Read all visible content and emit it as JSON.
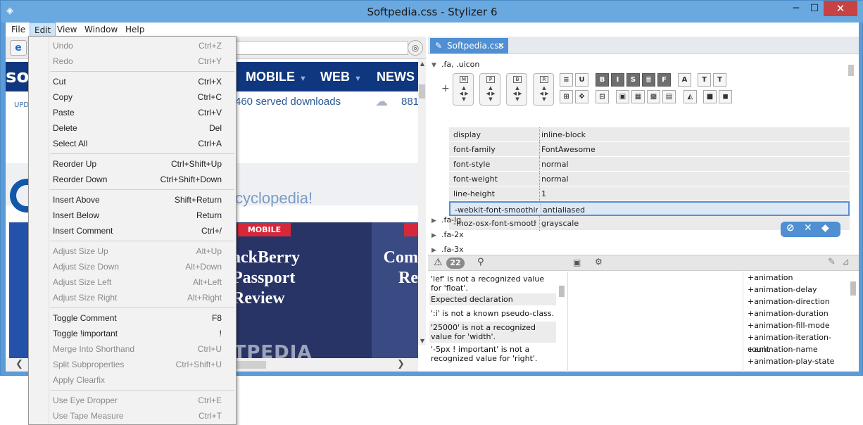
{
  "window": {
    "title": "Softpedia.css - Stylizer 6",
    "minimize": "─",
    "maximize": "☐",
    "close": "✕"
  },
  "menubar": [
    "File",
    "Edit",
    "View",
    "Window",
    "Help"
  ],
  "edit_menu": [
    {
      "label": "Undo",
      "shortcut": "Ctrl+Z",
      "enabled": false
    },
    {
      "label": "Redo",
      "shortcut": "Ctrl+Y",
      "enabled": false
    },
    {
      "label": "Cut",
      "shortcut": "Ctrl+X",
      "enabled": true
    },
    {
      "label": "Copy",
      "shortcut": "Ctrl+C",
      "enabled": true
    },
    {
      "label": "Paste",
      "shortcut": "Ctrl+V",
      "enabled": true
    },
    {
      "label": "Delete",
      "shortcut": "Del",
      "enabled": true
    },
    {
      "label": "Select All",
      "shortcut": "Ctrl+A",
      "enabled": true
    },
    {
      "label": "Reorder Up",
      "shortcut": "Ctrl+Shift+Up",
      "enabled": true
    },
    {
      "label": "Reorder Down",
      "shortcut": "Ctrl+Shift+Down",
      "enabled": true
    },
    {
      "label": "Insert Above",
      "shortcut": "Shift+Return",
      "enabled": true
    },
    {
      "label": "Insert Below",
      "shortcut": "Return",
      "enabled": true
    },
    {
      "label": "Insert Comment",
      "shortcut": "Ctrl+/",
      "enabled": true
    },
    {
      "label": "Adjust Size Up",
      "shortcut": "Alt+Up",
      "enabled": false
    },
    {
      "label": "Adjust Size Down",
      "shortcut": "Alt+Down",
      "enabled": false
    },
    {
      "label": "Adjust Size Left",
      "shortcut": "Alt+Left",
      "enabled": false
    },
    {
      "label": "Adjust Size Right",
      "shortcut": "Alt+Right",
      "enabled": false
    },
    {
      "label": "Toggle Comment",
      "shortcut": "F8",
      "enabled": true
    },
    {
      "label": "Toggle !important",
      "shortcut": "!",
      "enabled": true
    },
    {
      "label": "Merge Into Shorthand",
      "shortcut": "Ctrl+U",
      "enabled": false
    },
    {
      "label": "Split Subproperties",
      "shortcut": "Ctrl+Shift+U",
      "enabled": false
    },
    {
      "label": "Apply Clearfix",
      "shortcut": "",
      "enabled": false
    },
    {
      "label": "Use Eye Dropper",
      "shortcut": "Ctrl+E",
      "enabled": false
    },
    {
      "label": "Use Tape Measure",
      "shortcut": "Ctrl+T",
      "enabled": false
    }
  ],
  "browser": {
    "logo": "so",
    "nav": [
      "MOBILE",
      "WEB",
      "NEWS"
    ],
    "updates": "UPD",
    "downloads": "460  served downloads",
    "count": "881",
    "tagline": "cyclopedia!",
    "tag": "MOBILE",
    "headline": "ackBerry\nPassport\nReview",
    "headline2": "Com\nRe",
    "watermark": "SOFTPEDIA"
  },
  "editor": {
    "tab": "Softpedia.css",
    "selector_open": ".fa, .uicon",
    "properties": [
      {
        "name": "display",
        "value": "inline-block"
      },
      {
        "name": "font-family",
        "value": "FontAwesome"
      },
      {
        "name": "font-style",
        "value": "normal"
      },
      {
        "name": "font-weight",
        "value": "normal"
      },
      {
        "name": "line-height",
        "value": "1"
      },
      {
        "name": "-webkit-font-smoothing",
        "value": "antialiased"
      },
      {
        "name": "-moz-osx-font-smooth…",
        "value": "grayscale"
      }
    ],
    "selectors": [
      ".fa-lg",
      ".fa-2x",
      ".fa-3x"
    ]
  },
  "warnings": {
    "count": "22",
    "items": [
      "'lef' is not a recognized value for 'float'.",
      "Expected declaration",
      "':i' is not a known pseudo-class.",
      "'25000' is not a recognized value for 'width'.",
      "'-5px ! important' is not a recognized value for 'right'."
    ]
  },
  "animations": [
    "+animation",
    "+animation-delay",
    "+animation-direction",
    "+animation-duration",
    "+animation-fill-mode",
    "+animation-iteration-count",
    "+animation-name",
    "+animation-play-state"
  ]
}
